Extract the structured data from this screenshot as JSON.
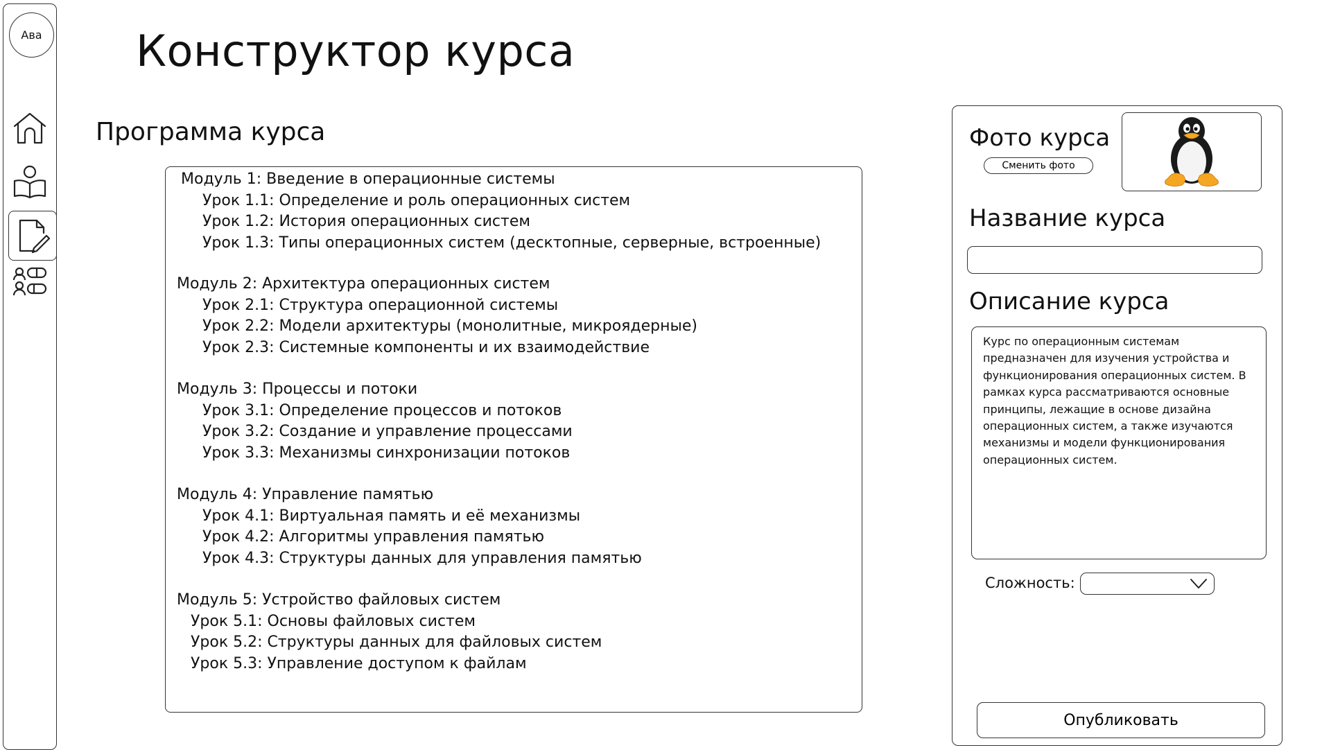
{
  "sidebar": {
    "avatar_text": "Ава",
    "items": [
      {
        "icon": "home-icon"
      },
      {
        "icon": "user-book-icon"
      },
      {
        "icon": "document-edit-icon",
        "active": true
      },
      {
        "icon": "users-toggles-icon"
      }
    ]
  },
  "header": {
    "title": "Конструктор курса"
  },
  "program": {
    "title": "Программа курса",
    "modules": [
      {
        "title": "Модуль 1: Введение в операционные системы",
        "lessons": [
          "Урок 1.1: Определение и роль операционных систем",
          "Урок 1.2: История операционных систем",
          "Урок 1.3: Типы операционных систем (десктопные, серверные, встроенные)"
        ]
      },
      {
        "title": "Модуль 2: Архитектура операционных систем",
        "lessons": [
          "Урок 2.1: Структура операционной системы",
          "Урок 2.2: Модели архитектуры (монолитные, микроядерные)",
          "Урок 2.3: Системные компоненты и их взаимодействие"
        ]
      },
      {
        "title": "Модуль 3: Процессы и потоки",
        "lessons": [
          "Урок 3.1: Определение процессов и потоков",
          "Урок 3.2: Создание и управление процессами",
          "Урок 3.3: Механизмы синхронизации потоков"
        ]
      },
      {
        "title": "Модуль 4: Управление памятью",
        "lessons": [
          "Урок 4.1: Виртуальная память и её механизмы",
          "Урок 4.2: Алгоритмы управления памятью",
          "Урок 4.3: Структуры данных для управления памятью"
        ]
      },
      {
        "title": "Модуль 5: Устройство файловых систем",
        "lessons": [
          "Урок 5.1: Основы файловых систем",
          "Урок 5.2: Структуры данных для файловых систем",
          "Урок 5.3: Управление доступом к файлам"
        ]
      }
    ]
  },
  "panel": {
    "photo_title": "Фото курса",
    "change_photo_label": "Сменить фото",
    "photo_icon": "linux-penguin-icon",
    "name_title": "Название курса",
    "name_value": "",
    "description_title": "Описание курса",
    "description_text": "Курс по операционным системам предназначен для изучения устройства и функционирования операционных систем. В рамках курса рассматриваются основные принципы, лежащие в основе дизайна операционных систем, а также изучаются механизмы и модели функционирования операционных систем.",
    "difficulty_label": "Сложность:",
    "difficulty_value": "",
    "publish_label": "Опубликовать"
  }
}
